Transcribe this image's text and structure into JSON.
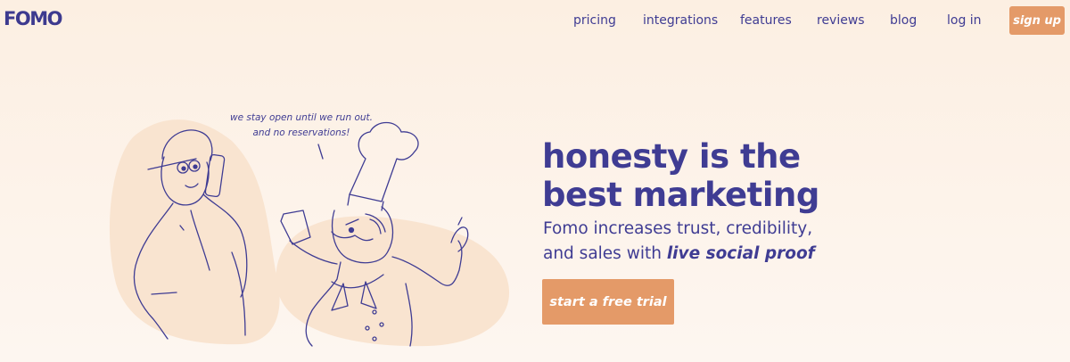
{
  "brand": {
    "logo_text": "FOMO"
  },
  "nav": {
    "items": [
      {
        "label": "pricing"
      },
      {
        "label": "integrations"
      },
      {
        "label": "features"
      },
      {
        "label": "reviews"
      },
      {
        "label": "blog"
      },
      {
        "label": "log in"
      }
    ],
    "signup_label": "sign up"
  },
  "hero": {
    "speech_line1": "we stay open until we run out.",
    "speech_line2": "and no reservations!",
    "headline_line1": "honesty is the",
    "headline_line2": "best marketing",
    "sub_line1": "Fomo increases trust, credibility,",
    "sub_line2_prefix": "and sales with ",
    "sub_line2_emphasis": "live social proof",
    "cta_label": "start a free trial"
  },
  "colors": {
    "brand_indigo": "#3f3c93",
    "accent_orange": "#e49a68",
    "background_peach": "#fcefe2",
    "blob": "#f9e6d4"
  }
}
